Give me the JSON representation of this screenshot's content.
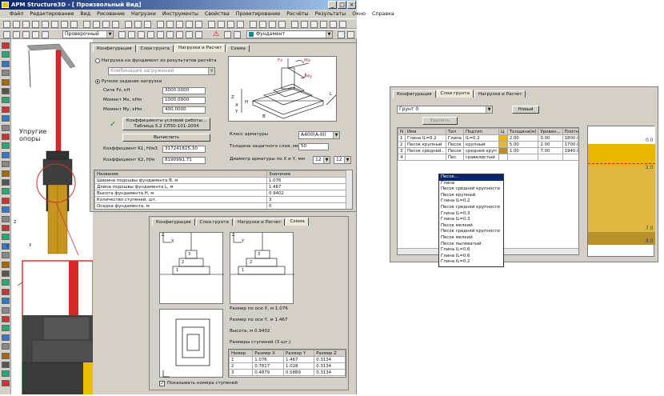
{
  "app": {
    "title": "APM Structure3D - [ Произвольный Вид]"
  },
  "menu": [
    "Файл",
    "Редактирование",
    "Вид",
    "Рисование",
    "Нагрузки",
    "Инструменты",
    "Свойства",
    "Проектирование",
    "Расчёты",
    "Результаты",
    "Окно",
    "Справка"
  ],
  "toolbar": {
    "mode_combo": "Проверочный",
    "element_combo": "Фундамент"
  },
  "viewport": {
    "annotation": "Упругие\nопоры",
    "axis_z": "Z",
    "axis_x": "X",
    "axis_y": "Y"
  },
  "colors": {
    "red": "#d8282a",
    "steel": "#c8961e",
    "concrete": "#4a4a4a",
    "gold": "#e8b800"
  },
  "dialog1": {
    "tabs": [
      "Конфигурация",
      "Слои грунта",
      "Нагрузки и Расчет",
      "Схема"
    ],
    "active_tab": 2,
    "radio_from_calc": "Нагрузка на фундамент из результатов расчёта",
    "combo_comb": "Комбинация загружений",
    "radio_manual": "Ручное задание нагрузки",
    "fields": [
      {
        "label": "Сила Fz, кН",
        "value": "3000.0000"
      },
      {
        "label": "Момент Mx, кНм",
        "value": "1000.0000"
      },
      {
        "label": "Момент My, кНм",
        "value": "400.0000"
      }
    ],
    "coef_button": "Коэффициенты условий работы...",
    "coef_sub": "Таблица 5.2 СП50-101-2004",
    "calc_button": "Вычислить",
    "k1_label": "Коэффициент K1, Н/м3",
    "k1_value": "317241825.30",
    "k2_label": "Коэффициент K2, Н/м",
    "k2_value": "8190991.71",
    "rebar_class_label": "Класс арматуры",
    "rebar_class": "A400(A-III)",
    "cover_label": "Толщина защитного слоя, мм",
    "cover_value": "50",
    "diam_label": "Диаметр арматуры по X и Y, мм",
    "diam_x": "12",
    "diam_y": "12",
    "results_headers": [
      "Название",
      "Значение"
    ],
    "results": [
      [
        "Ширина подошвы фундамента B, м",
        "1.076"
      ],
      [
        "Длина подошвы фундамента L, м",
        "1.467"
      ],
      [
        "Высота фундамента H, м",
        "0.9402"
      ],
      [
        "Количество ступеней, шт.",
        "3"
      ],
      [
        "Осадка фундамента, м",
        "0"
      ]
    ],
    "diag_labels": {
      "fz": "Fz",
      "mx": "Mx",
      "my": "My",
      "z": "Z",
      "x": "X",
      "y": "Y",
      "l": "L",
      "h": "H",
      "b": "B"
    }
  },
  "dialog2": {
    "tabs": [
      "Конфигурация",
      "Слои грунта",
      "Нагрузки и Расчет",
      "Схема"
    ],
    "active_tab": 3,
    "size_x": "Размер по оси X, м      1.076",
    "size_y": "Размер по оси Y, м      1.467",
    "height": "Высота, м      0.9402",
    "steps": "Размеры ступеней (3 шт.)",
    "table_headers": [
      "Номер",
      "Размер X",
      "Размер Y",
      "Размер Z"
    ],
    "table_rows": [
      [
        "1",
        "1.076",
        "1.467",
        "0.3134"
      ],
      [
        "2",
        "0.7817",
        "1.028",
        "0.3134"
      ],
      [
        "3",
        "0.4879",
        "0.5889",
        "0.3134"
      ]
    ],
    "checkbox": "Показывать номера ступеней",
    "step_nums": [
      "1",
      "2",
      "3"
    ],
    "axis_z": "Z",
    "axis_x": "X",
    "axis_y": "Y"
  },
  "dialog3": {
    "tabs": [
      "Конфигурация",
      "Слои грунта",
      "Нагрузки и Расчет"
    ],
    "active_tab": 1,
    "soil_combo": "Грунт 0",
    "new_button": "Новый",
    "delete_button": "Удалить",
    "headers": [
      "N",
      "Имя",
      "Тип",
      "Подтип",
      "Ц.",
      "Толщина(м)",
      "Уровен...",
      "Плотн."
    ],
    "rows": [
      [
        "1",
        "Глина IL=0.2",
        "Глина",
        "IL=0.2",
        "",
        "2.00",
        "0.00",
        "1800.00"
      ],
      [
        "2",
        "Песок крупный",
        "Песок",
        "крупный",
        "",
        "5.00",
        "2.00",
        "1700.00"
      ],
      [
        "3",
        "Песок средней..",
        "Песок",
        "средней круп",
        "",
        "1.00",
        "7.00",
        "1940.00"
      ],
      [
        "4",
        "",
        "Пес",
        "гравелистый",
        "",
        "",
        "",
        ""
      ]
    ],
    "swatches": [
      "#e8b800",
      "#e0b840",
      "#b8902a"
    ],
    "dropdown": [
      "Песок...",
      "Глина",
      "Песок средней крупности",
      "Песок крупный",
      "Глина IL=0.2",
      "Песок средней крупности",
      "Глина IL=0.3",
      "Глина IL=0.3",
      "Песок мелкий",
      "Песок средней крупности",
      "Песок мелкий",
      "Песок пылеватый",
      "Глина IL=0.6",
      "Глина IL=0.6",
      "Глина IL=0.2"
    ],
    "depth_labels": [
      "0.0",
      "2.0",
      "7.0",
      "8.0"
    ]
  }
}
